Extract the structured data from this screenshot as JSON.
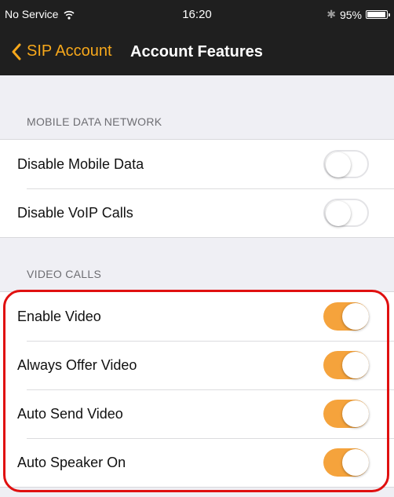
{
  "status_bar": {
    "carrier": "No Service",
    "time": "16:20",
    "battery_percent": "95%",
    "battery_level": 0.95,
    "icons": [
      "wifi-icon",
      "bluetooth-icon",
      "battery-icon"
    ]
  },
  "nav": {
    "back_label": "SIP Account",
    "title": "Account Features"
  },
  "sections": {
    "mobile": {
      "header": "MOBILE DATA NETWORK",
      "rows": [
        {
          "label": "Disable Mobile Data",
          "on": false
        },
        {
          "label": "Disable VoIP Calls",
          "on": false
        }
      ]
    },
    "video": {
      "header": "VIDEO CALLS",
      "rows": [
        {
          "label": "Enable Video",
          "on": true
        },
        {
          "label": "Always Offer Video",
          "on": true
        },
        {
          "label": "Auto Send Video",
          "on": true
        },
        {
          "label": "Auto Speaker On",
          "on": true
        }
      ]
    }
  },
  "colors": {
    "accent": "#f7a81b",
    "toggle_on": "#f5a33c",
    "bar_background": "#1f1f1f",
    "highlight": "#e01010"
  }
}
